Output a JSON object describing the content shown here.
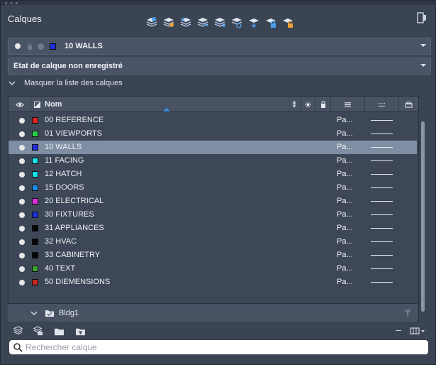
{
  "panel": {
    "title": "Calques"
  },
  "current_layer": {
    "name": "10 WALLS",
    "color": "#1d2fe0"
  },
  "layer_state": {
    "label": "Etat de calque non enregistré"
  },
  "list_toggle": {
    "label": "Masquer la liste des calques"
  },
  "table": {
    "header": {
      "name_label": "Nom"
    },
    "rows": [
      {
        "name": "00 REFERENCE",
        "color": "#e0261d",
        "linetype": "Pa...",
        "selected": false
      },
      {
        "name": "01 VIEWPORTS",
        "color": "#27d34a",
        "linetype": "Pa...",
        "selected": false
      },
      {
        "name": "10 WALLS",
        "color": "#1d2fe0",
        "linetype": "Pa...",
        "selected": true
      },
      {
        "name": "11 FACING",
        "color": "#16e3ee",
        "linetype": "Pa...",
        "selected": false
      },
      {
        "name": "12 HATCH",
        "color": "#16e3ee",
        "linetype": "Pa...",
        "selected": false
      },
      {
        "name": "15 DOORS",
        "color": "#1c8ef0",
        "linetype": "Pa...",
        "selected": false
      },
      {
        "name": "20 ELECTRICAL",
        "color": "#e22ee0",
        "linetype": "Pa...",
        "selected": false
      },
      {
        "name": "30 FIXTURES",
        "color": "#1d2fe0",
        "linetype": "Pa...",
        "selected": false
      },
      {
        "name": "31 APPLIANCES",
        "color": "#050505",
        "linetype": "Pa...",
        "selected": false
      },
      {
        "name": "32 HVAC",
        "color": "#050505",
        "linetype": "Pa...",
        "selected": false
      },
      {
        "name": "33 CABINETRY",
        "color": "#050505",
        "linetype": "Pa...",
        "selected": false
      },
      {
        "name": "40 TEXT",
        "color": "#3aa231",
        "linetype": "Pa...",
        "selected": false
      },
      {
        "name": "50 DIEMENSIONS",
        "color": "#c4261b",
        "linetype": "Pa...",
        "selected": false
      }
    ]
  },
  "group": {
    "name": "Bldg1"
  },
  "search": {
    "placeholder": "Rechercher calque"
  },
  "colors": {
    "panel_bg": "#3b4453",
    "selected_row": "#7f8ea3",
    "accent": "#3d8fe0"
  },
  "icons": {
    "toolbar": [
      "new-layer-icon",
      "new-layer-frozen-icon",
      "delete-layer-icon",
      "set-current-icon",
      "match-layer-icon",
      "isolate-icon",
      "unisolate-icon",
      "lock-layer-icon",
      "unlock-layer-icon"
    ],
    "bottom": [
      "layer-stack-icon",
      "layer-properties-icon",
      "folder-open-icon",
      "folder-filter-icon"
    ]
  }
}
